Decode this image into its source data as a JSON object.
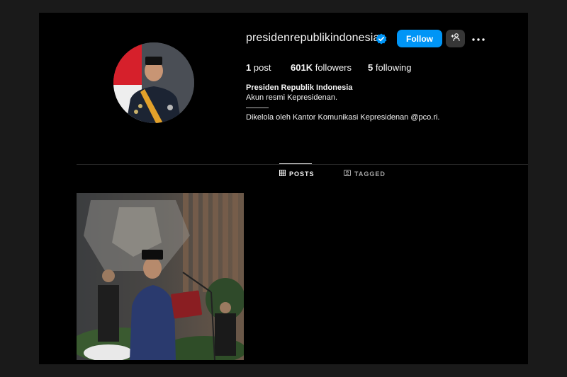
{
  "profile": {
    "username": "presidenrepublikindonesia",
    "verified_icon": "verified-badge-icon",
    "follow_label": "Follow",
    "suggest_icon": "add-person-icon",
    "more_icon": "more-options-icon",
    "stats": {
      "posts_count": "1",
      "posts_label": "post",
      "followers_count": "601K",
      "followers_label": "followers",
      "following_count": "5",
      "following_label": "following"
    },
    "bio": {
      "name": "Presiden Republik Indonesia",
      "line1": "Akun resmi Kepresidenan.",
      "line2": "Dikelola oleh Kantor Komunikasi Kepresidenan @pco.ri."
    }
  },
  "tabs": [
    {
      "label": "POSTS",
      "icon": "grid-icon",
      "active": true
    },
    {
      "label": "TAGGED",
      "icon": "tagged-icon",
      "active": false
    }
  ],
  "colors": {
    "accent": "#0095f6",
    "background": "#000000",
    "verified": "#0095f6"
  }
}
